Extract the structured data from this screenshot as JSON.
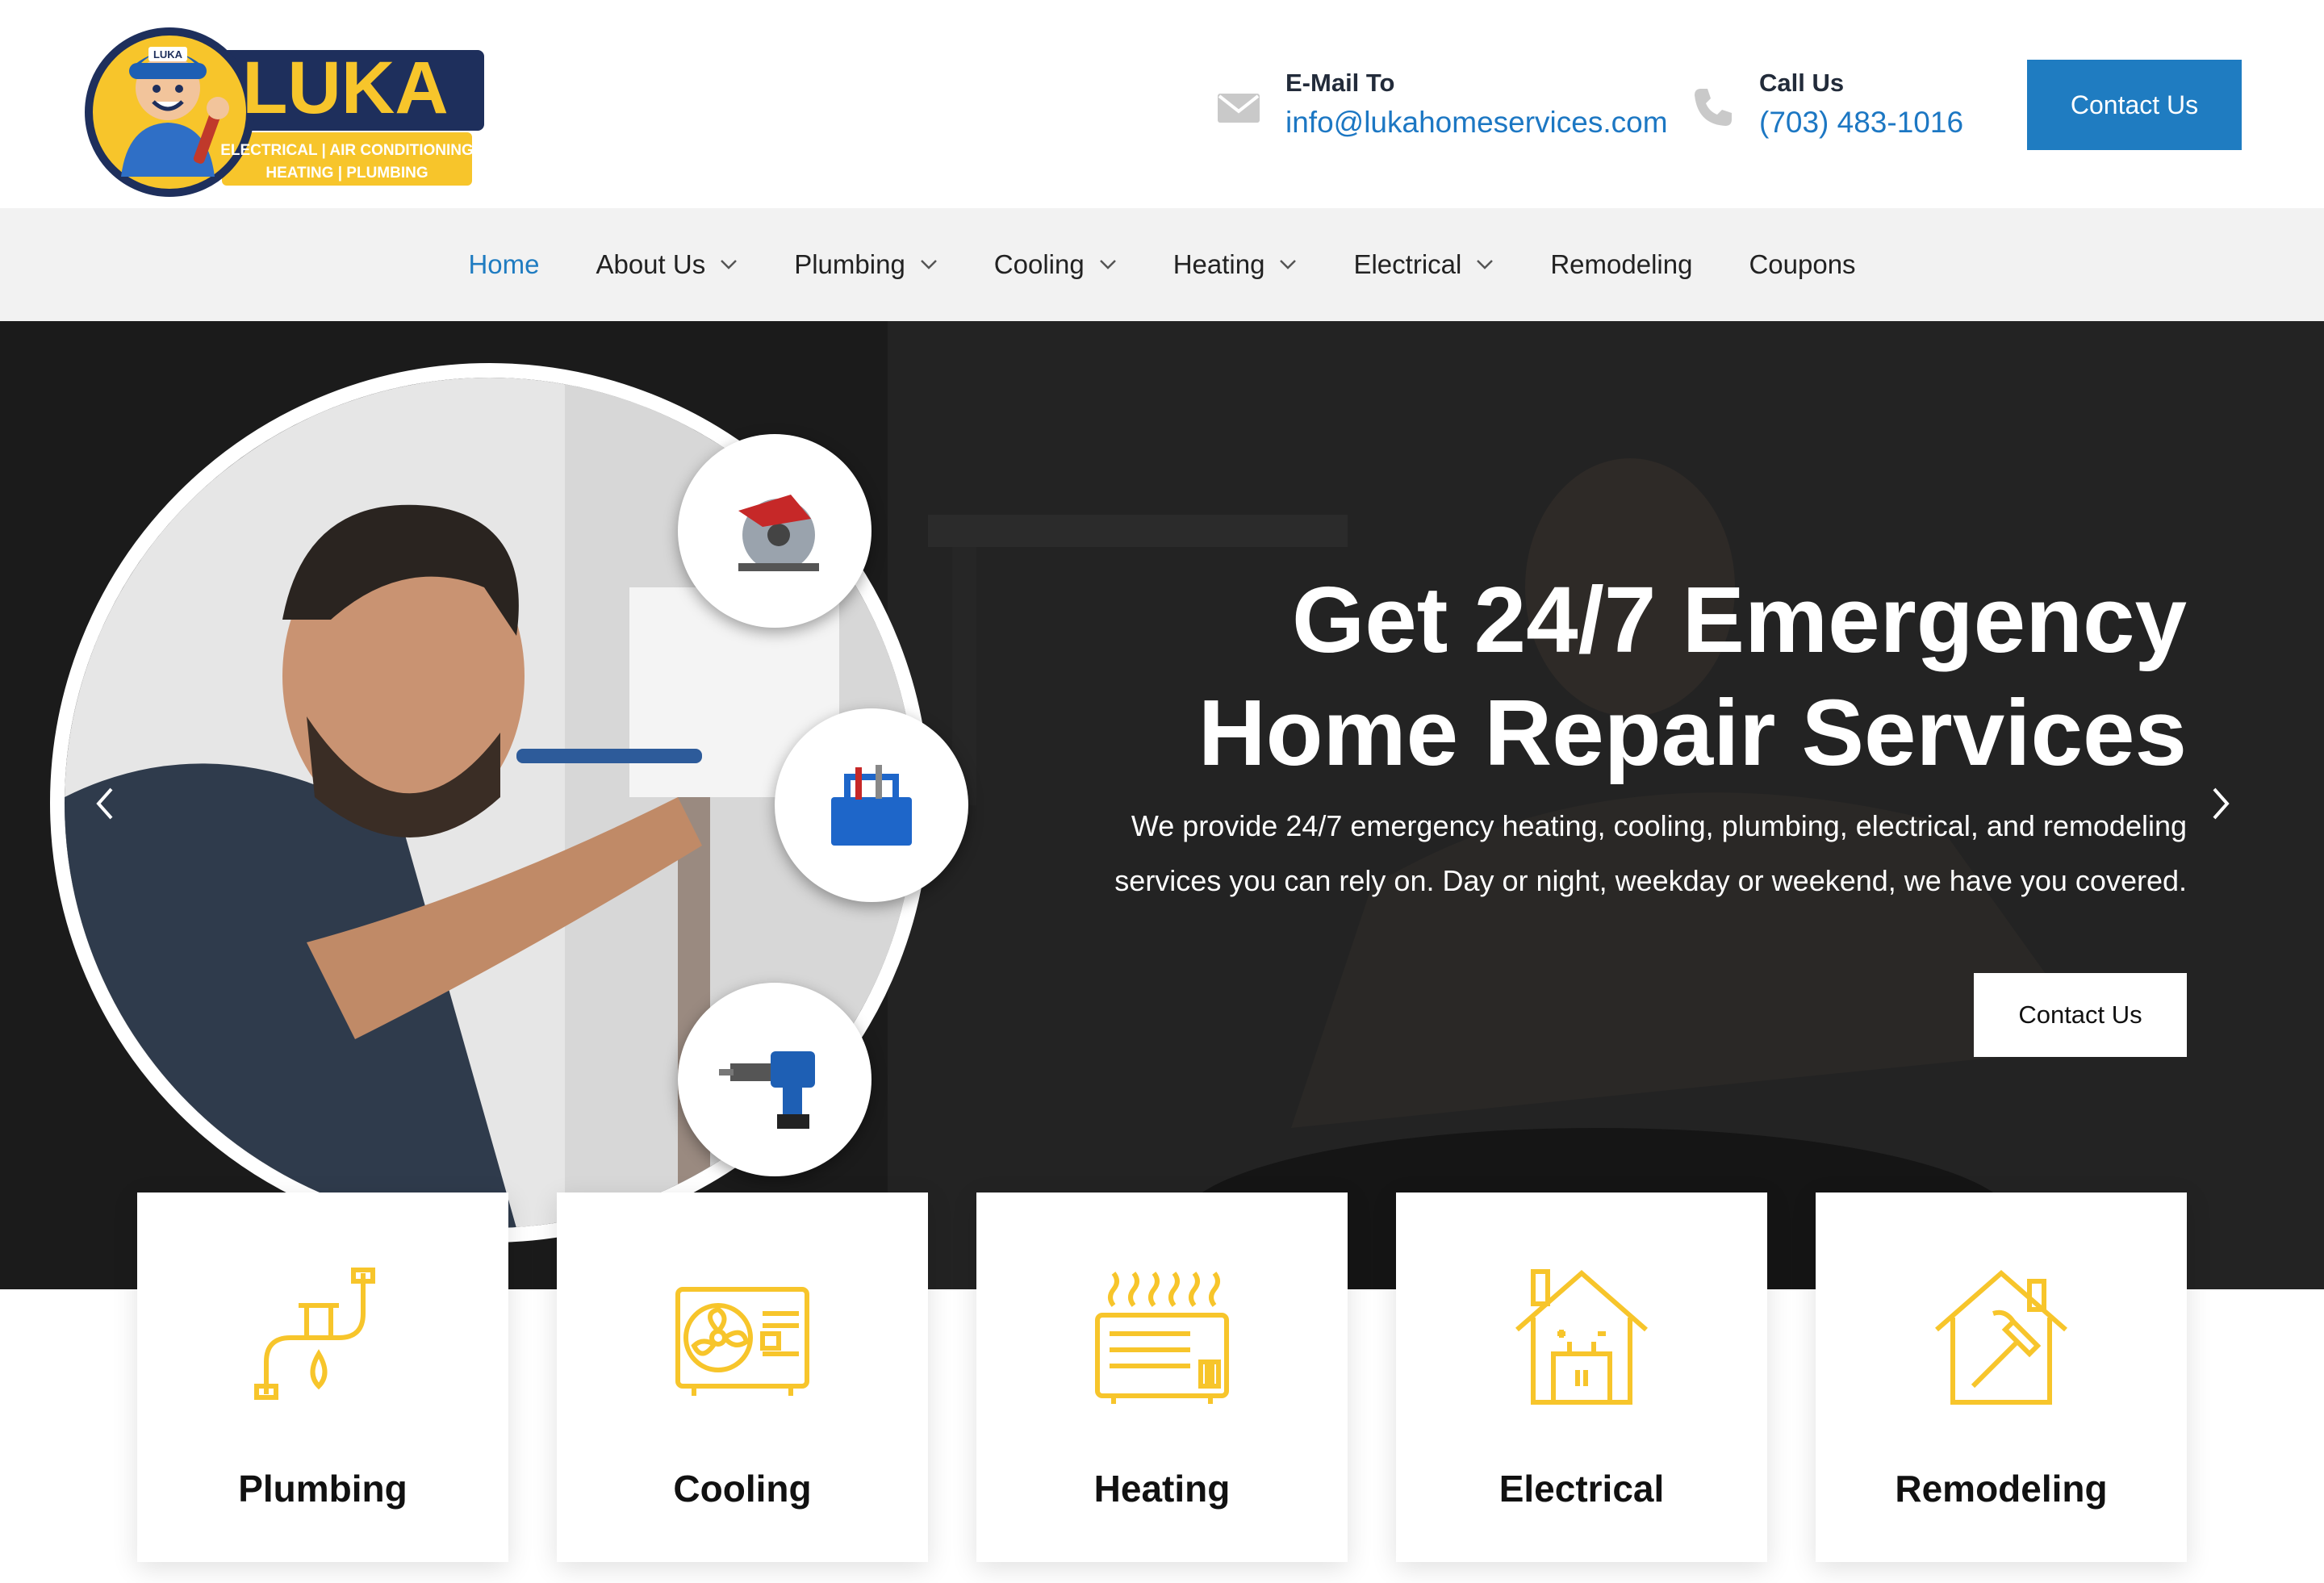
{
  "brand": {
    "name": "LUKA",
    "tagline_line1": "ELECTRICAL | AIR CONDITIONING",
    "tagline_line2": "HEATING | PLUMBING",
    "cap_text": "LUKA"
  },
  "header": {
    "email_label": "E-Mail To",
    "email_value": "info@lukahomeservices.com",
    "phone_label": "Call Us",
    "phone_value": "(703) 483-1016",
    "cta_label": "Contact Us"
  },
  "nav": {
    "items": [
      {
        "label": "Home",
        "active": true,
        "dropdown": false
      },
      {
        "label": "About Us",
        "active": false,
        "dropdown": true
      },
      {
        "label": "Plumbing",
        "active": false,
        "dropdown": true
      },
      {
        "label": "Cooling",
        "active": false,
        "dropdown": true
      },
      {
        "label": "Heating",
        "active": false,
        "dropdown": true
      },
      {
        "label": "Electrical",
        "active": false,
        "dropdown": true
      },
      {
        "label": "Remodeling",
        "active": false,
        "dropdown": false
      },
      {
        "label": "Coupons",
        "active": false,
        "dropdown": false
      }
    ]
  },
  "hero": {
    "title_line1": "Get 24/7 Emergency",
    "title_line2": "Home Repair Services",
    "subtitle_line1": "We provide 24/7 emergency heating, cooling, plumbing, electrical, and remodeling",
    "subtitle_line2": "services you can rely on. Day or night, weekday or weekend, we have you covered.",
    "cta_label": "Contact Us"
  },
  "services": [
    {
      "title": "Plumbing",
      "icon": "plumbing-pipe-icon"
    },
    {
      "title": "Cooling",
      "icon": "ac-unit-icon"
    },
    {
      "title": "Heating",
      "icon": "heater-icon"
    },
    {
      "title": "Electrical",
      "icon": "electrical-house-icon"
    },
    {
      "title": "Remodeling",
      "icon": "remodel-house-icon"
    }
  ],
  "colors": {
    "accent_blue": "#1f7cc1",
    "brand_yellow": "#f7c52b",
    "brand_navy": "#1e2f5c",
    "icon_yellow": "#f7c52b"
  }
}
